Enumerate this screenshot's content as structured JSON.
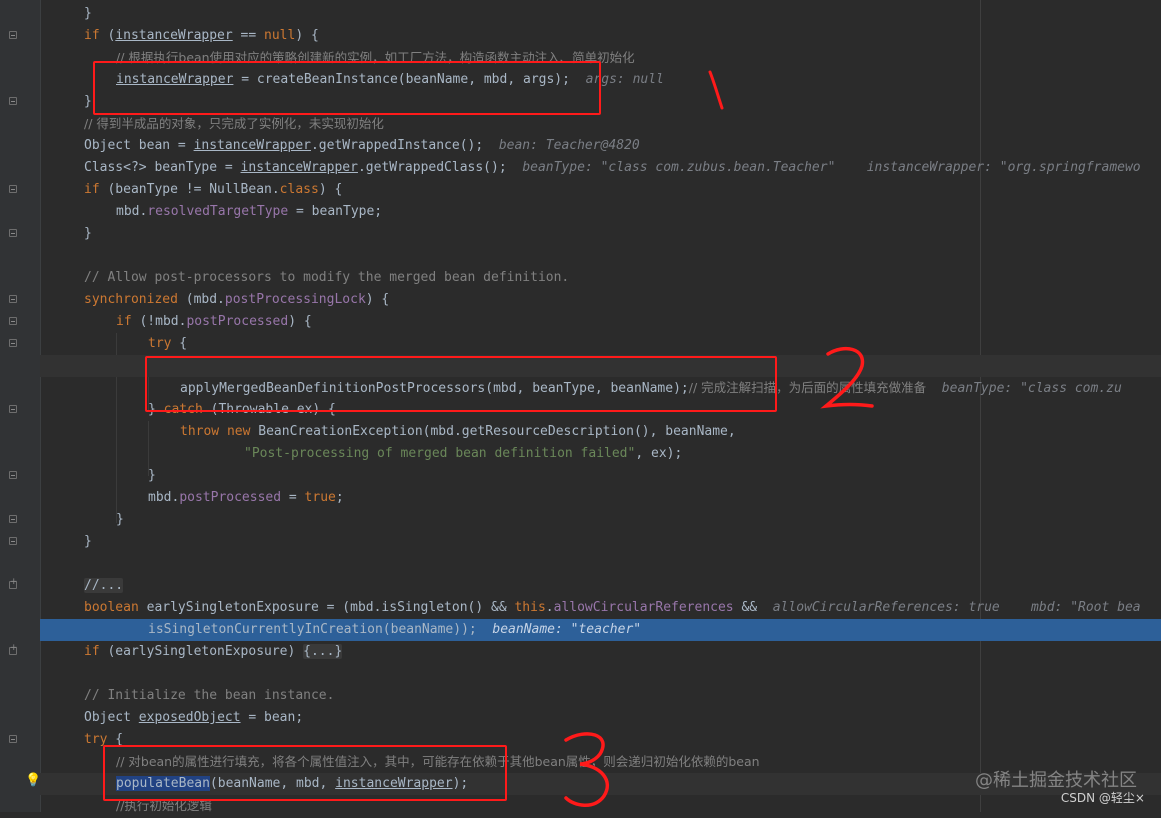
{
  "editor": {
    "lines": {
      "l1": "}",
      "l2_kw": "if",
      "l2_var": "instanceWrapper",
      "l2_eq": " == ",
      "l2_null": "null",
      "l2_end": ") {",
      "l3": "// 根据执行bean使用对应的策略创建新的实例，如工厂方法，构造函数主动注入、简单初始化",
      "l4_var": "instanceWrapper",
      "l4_rest": " = createBeanInstance(beanName, mbd, args);",
      "l4_hint": "args: null",
      "l5": "}",
      "l6": "// 得到半成品的对象，只完成了实例化，未实现初始化",
      "l7_a": "Object bean = ",
      "l7_var": "instanceWrapper",
      "l7_b": ".getWrappedInstance();",
      "l7_hint": "bean: Teacher@4820",
      "l8_a": "Class<?> beanType = ",
      "l8_var": "instanceWrapper",
      "l8_b": ".getWrappedClass();",
      "l8_hint": "beanType: \"class com.zubus.bean.Teacher\"    instanceWrapper: \"org.springframewo",
      "l9_kw": "if",
      "l9_a": " (beanType != NullBean.",
      "l9_cls": "class",
      "l9_b": ") {",
      "l10_a": "mbd.",
      "l10_fld": "resolvedTargetType",
      "l10_b": " = beanType;",
      "l11": "}",
      "l13": "// Allow post-processors to modify the merged bean definition.",
      "l14_kw": "synchronized",
      "l14_a": " (mbd.",
      "l14_fld": "postProcessingLock",
      "l14_b": ") {",
      "l15_kw": "if",
      "l15_a": " (!mbd.",
      "l15_fld": "postProcessed",
      "l15_b": ") {",
      "l16_kw": "try",
      "l16_b": " {",
      "l18_code": "applyMergedBeanDefinitionPostProcessors(mbd, beanType, beanName);",
      "l18_cm": "// 完成注解扫描，为后面的属性填充做准备",
      "l18_hint": "beanType: \"class com.zu",
      "l19_a": "} ",
      "l19_kw": "catch",
      "l19_b": " (Throwable ex) {",
      "l20_kw1": "throw",
      "l20_kw2": "new",
      "l20_rest": " BeanCreationException(mbd.getResourceDescription(), beanName,",
      "l21_str": "\"Post-processing of merged bean definition failed\"",
      "l21_rest": ", ex);",
      "l22": "}",
      "l23_a": "mbd.",
      "l23_fld": "postProcessed",
      "l23_b": " = ",
      "l23_kw": "true",
      "l23_c": ";",
      "l24": "}",
      "l25": "}",
      "l27": "//...",
      "l28_kw": "boolean",
      "l28_a": " earlySingletonExposure = (mbd.isSingleton() && ",
      "l28_this": "this",
      "l28_b": ".",
      "l28_fld": "allowCircularReferences",
      "l28_c": " &&",
      "l28_hint": "allowCircularReferences: true    mbd: \"Root bea",
      "l29_code": "isSingletonCurrentlyInCreation(beanName));",
      "l29_hint": "beanName: \"teacher\"",
      "l30_kw": "if",
      "l30_a": " (earlySingletonExposure) ",
      "l30_fold": "{...}",
      "l32": "// Initialize the bean instance.",
      "l33_a": "Object ",
      "l33_var": "exposedObject",
      "l33_b": " = bean;",
      "l34_kw": "try",
      "l34_b": " {",
      "l35": "// 对bean的属性进行填充，将各个属性值注入，其中，可能存在依赖于其他bean属性，则会递归初始化依赖的bean",
      "l36_sel": "populateBean",
      "l36_a": "(beanName, mbd, ",
      "l36_var": "instanceWrapper",
      "l36_b": ");",
      "l37": "//执行初始化逻辑"
    }
  },
  "annotations": {
    "mark1": "1",
    "mark2": "2",
    "mark3": "3",
    "ink_color": "#ff1a1a"
  },
  "watermark": {
    "site": "@稀土掘金技术社区",
    "csdn": "CSDN @轻尘×"
  },
  "colors": {
    "background": "#2b2b2b",
    "execution_line": "#2d6099",
    "keyword": "#cc7832",
    "comment": "#808080",
    "string": "#6a8759",
    "field": "#9876aa"
  }
}
